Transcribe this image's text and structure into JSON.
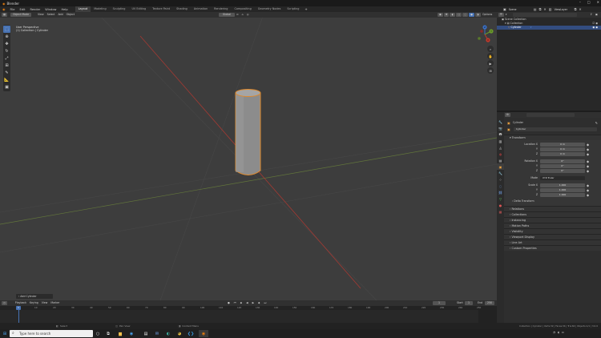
{
  "window": {
    "title": "Blender"
  },
  "menus": [
    "File",
    "Edit",
    "Render",
    "Window",
    "Help"
  ],
  "workspaces": [
    {
      "label": "Layout",
      "active": true
    },
    {
      "label": "Modeling",
      "active": false
    },
    {
      "label": "Sculpting",
      "active": false
    },
    {
      "label": "UV Editing",
      "active": false
    },
    {
      "label": "Texture Paint",
      "active": false
    },
    {
      "label": "Shading",
      "active": false
    },
    {
      "label": "Animation",
      "active": false
    },
    {
      "label": "Rendering",
      "active": false
    },
    {
      "label": "Compositing",
      "active": false
    },
    {
      "label": "Geometry Nodes",
      "active": false
    },
    {
      "label": "Scripting",
      "active": false
    }
  ],
  "topright": {
    "scene_label": "Scene",
    "view_layer_label": "ViewLayer"
  },
  "viewport": {
    "header": {
      "mode": "Object Mode",
      "menus": [
        "View",
        "Select",
        "Add",
        "Object"
      ],
      "orientation": "Global",
      "options_label": "Options"
    },
    "info_line1": "User Perspective",
    "info_line2": "(1) Collection | Cylinder",
    "last_operator": "Add Cylinder",
    "gizmo": {
      "x": "X",
      "y": "Y",
      "z": "Z"
    }
  },
  "timeline": {
    "menus": [
      "Playback",
      "Keying",
      "View",
      "Marker"
    ],
    "current_frame": "1",
    "start_label": "Start",
    "start": "1",
    "end_label": "End",
    "end": "250",
    "ticks": [
      "0",
      "10",
      "20",
      "30",
      "40",
      "50",
      "60",
      "70",
      "80",
      "90",
      "100",
      "110",
      "120",
      "130",
      "140",
      "150",
      "160",
      "170",
      "180",
      "190",
      "200",
      "210",
      "220",
      "230",
      "240",
      "250"
    ]
  },
  "statusbar": {
    "left": "Select",
    "mid": "Pan View",
    "mid2": "Context Menu",
    "right": "Collection | Cylinder | Verts:32 | Faces:34 | Tris:60 | Objects:1/1 | 3.0.0"
  },
  "taskbar": {
    "search_placeholder": "Type here to search"
  },
  "outliner": {
    "search_placeholder": "",
    "rows": [
      {
        "label": "Scene Collection",
        "selected": false,
        "indent": 0
      },
      {
        "label": "Collection",
        "selected": false,
        "indent": 1
      },
      {
        "label": "Cylinder",
        "selected": true,
        "indent": 2
      }
    ]
  },
  "properties": {
    "object_name": "Cylinder",
    "object_data_name": "Cylinder",
    "transform_label": "Transform",
    "location_label": "Location X",
    "location": [
      "0 m",
      "0 m",
      "0 m"
    ],
    "rotation_label": "Rotation X",
    "rotation": [
      "0°",
      "0°",
      "0°"
    ],
    "mode_label": "Mode",
    "mode_value": "XYZ Euler",
    "scale_label": "Scale X",
    "scale": [
      "1.000",
      "1.000",
      "1.000"
    ],
    "axis_y": "Y",
    "axis_z": "Z",
    "panels": [
      "Delta Transform",
      "Relations",
      "Collections",
      "Instancing",
      "Motion Paths",
      "Visibility",
      "Viewport Display",
      "Line Art",
      "Custom Properties"
    ]
  },
  "colors": {
    "accent": "#4772b3",
    "selected_outline": "#e08a2c",
    "x_axis": "#c0392b",
    "y_axis": "#6a9a2a",
    "z_axis": "#3a6fc4"
  }
}
